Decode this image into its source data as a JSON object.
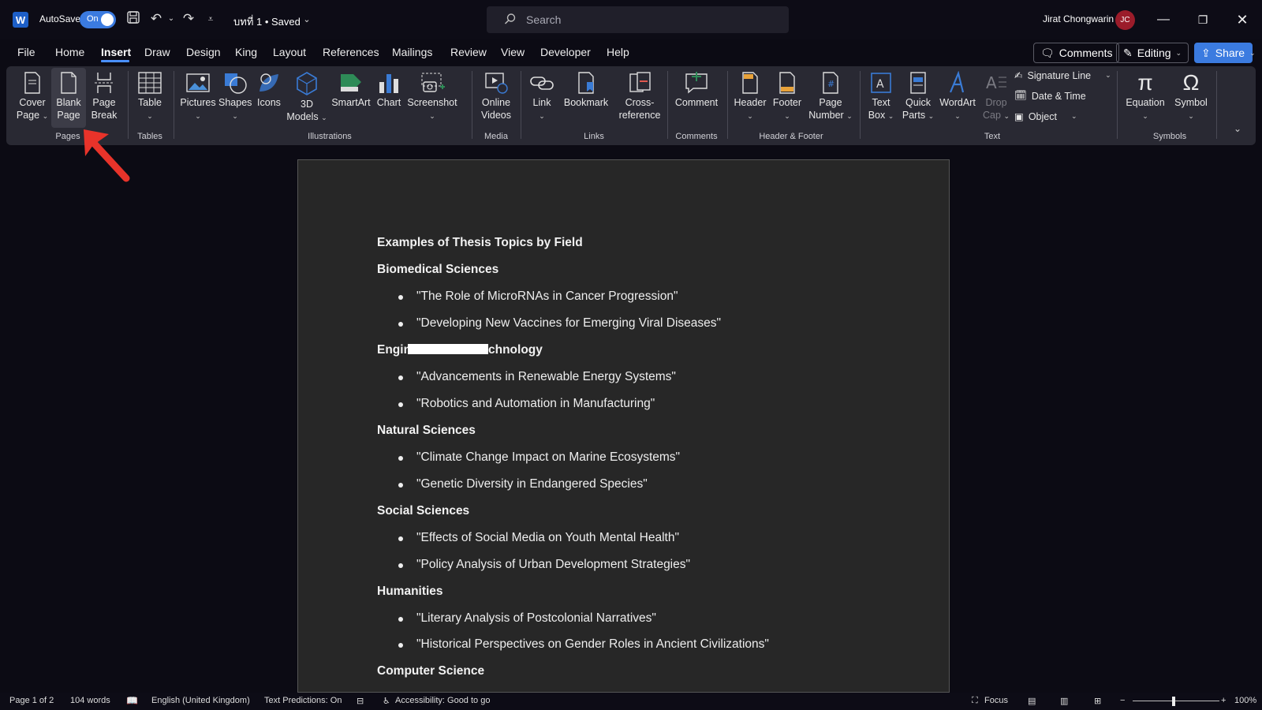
{
  "titlebar": {
    "autosave_label": "AutoSave",
    "autosave_state": "On",
    "doc_title": "บทที่ 1 • Saved",
    "search_placeholder": "Search",
    "user_name": "Jirat Chongwarin",
    "user_initials": "JC",
    "app_letter": "W"
  },
  "menu": {
    "tabs": [
      "File",
      "Home",
      "Insert",
      "Draw",
      "Design",
      "King",
      "Layout",
      "References",
      "Mailings",
      "Review",
      "View",
      "Developer",
      "Help"
    ],
    "active": "Insert",
    "comments_label": "Comments",
    "editing_label": "Editing",
    "share_label": "Share"
  },
  "ribbon": {
    "pages": {
      "label": "Pages",
      "cover_page": [
        "Cover",
        "Page"
      ],
      "blank_page": [
        "Blank",
        "Page"
      ],
      "page_break": [
        "Page",
        "Break"
      ]
    },
    "tables": {
      "label": "Tables",
      "table": "Table"
    },
    "illustrations": {
      "label": "Illustrations",
      "pictures": "Pictures",
      "shapes": "Shapes",
      "icons": "Icons",
      "models_3d": [
        "3D",
        "Models"
      ],
      "smartart": "SmartArt",
      "chart": "Chart",
      "screenshot": "Screenshot"
    },
    "media": {
      "label": "Media",
      "online_videos": [
        "Online",
        "Videos"
      ]
    },
    "links": {
      "label": "Links",
      "link": "Link",
      "bookmark": "Bookmark",
      "cross_reference": [
        "Cross-",
        "reference"
      ]
    },
    "comments": {
      "label": "Comments",
      "comment": "Comment"
    },
    "header_footer": {
      "label": "Header & Footer",
      "header": "Header",
      "footer": "Footer",
      "page_number": [
        "Page",
        "Number"
      ]
    },
    "text": {
      "label": "Text",
      "text_box": [
        "Text",
        "Box"
      ],
      "quick_parts": [
        "Quick",
        "Parts"
      ],
      "wordart": "WordArt",
      "drop_cap": [
        "Drop",
        "Cap"
      ],
      "signature_line": "Signature Line",
      "date_time": "Date & Time",
      "object": "Object"
    },
    "symbols": {
      "label": "Symbols",
      "equation": "Equation",
      "symbol": "Symbol"
    }
  },
  "document": {
    "title": "Examples of Thesis Topics by Field",
    "sections": [
      {
        "heading": "Biomedical Sciences",
        "items": [
          "\"The Role of MicroRNAs in Cancer Progression\"",
          "\"Developing New Vaccines for Emerging Viral Diseases\""
        ]
      },
      {
        "heading_left": "Engin",
        "heading_right": "chnology",
        "items": [
          "\"Advancements in Renewable Energy Systems\"",
          "\"Robotics and Automation in Manufacturing\""
        ]
      },
      {
        "heading": "Natural Sciences",
        "items": [
          "\"Climate Change Impact on Marine Ecosystems\"",
          "\"Genetic Diversity in Endangered Species\""
        ]
      },
      {
        "heading": "Social Sciences",
        "items": [
          "\"Effects of Social Media on Youth Mental Health\"",
          "\"Policy Analysis of Urban Development Strategies\""
        ]
      },
      {
        "heading": "Humanities",
        "items": [
          "\"Literary Analysis of Postcolonial Narratives\"",
          "\"Historical Perspectives on Gender Roles in Ancient Civilizations\""
        ]
      },
      {
        "heading": "Computer Science",
        "items": []
      }
    ]
  },
  "statusbar": {
    "page": "Page 1 of 2",
    "words": "104 words",
    "language": "English (United Kingdom)",
    "text_predictions": "Text Predictions: On",
    "accessibility": "Accessibility: Good to go",
    "focus": "Focus",
    "zoom": "100%",
    "zoom_percent": 100
  },
  "colors": {
    "accent": "#3b7be0",
    "annotation_arrow": "#e8332a",
    "avatar": "#9b1c2a"
  }
}
